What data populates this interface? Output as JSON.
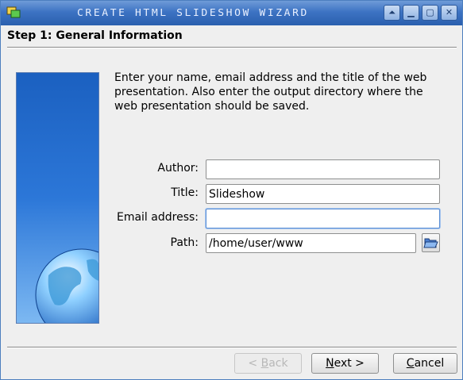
{
  "window": {
    "title": "Create HTML Slideshow Wizard",
    "controls": {
      "shade": "⏶",
      "minimize": "▁",
      "maximize": "▢",
      "close": "✕"
    }
  },
  "step": {
    "title": "Step 1: General Information",
    "intro": "Enter your name, email address and the title of the web presentation. Also enter the output directory where the web presentation should be saved."
  },
  "form": {
    "author": {
      "label": "Author:",
      "value": ""
    },
    "title": {
      "label": "Title:",
      "value": "Slideshow"
    },
    "email": {
      "label": "Email address:",
      "value": ""
    },
    "path": {
      "label": "Path:",
      "value": "/home/user/www"
    }
  },
  "buttons": {
    "back": {
      "prefix": "< ",
      "mnemonic": "B",
      "rest": "ack"
    },
    "next": {
      "mnemonic": "N",
      "rest": "ext >"
    },
    "cancel": {
      "mnemonic": "C",
      "rest": "ancel"
    }
  },
  "icons": {
    "app": "slideshow-app-icon",
    "browse": "folder-open-icon",
    "globe": "globe-icon"
  },
  "colors": {
    "titlebar": "#3d73c3",
    "sidebar_top": "#1b60c0",
    "sidebar_bottom": "#7cb8f2",
    "focus": "#5b8ed4"
  }
}
